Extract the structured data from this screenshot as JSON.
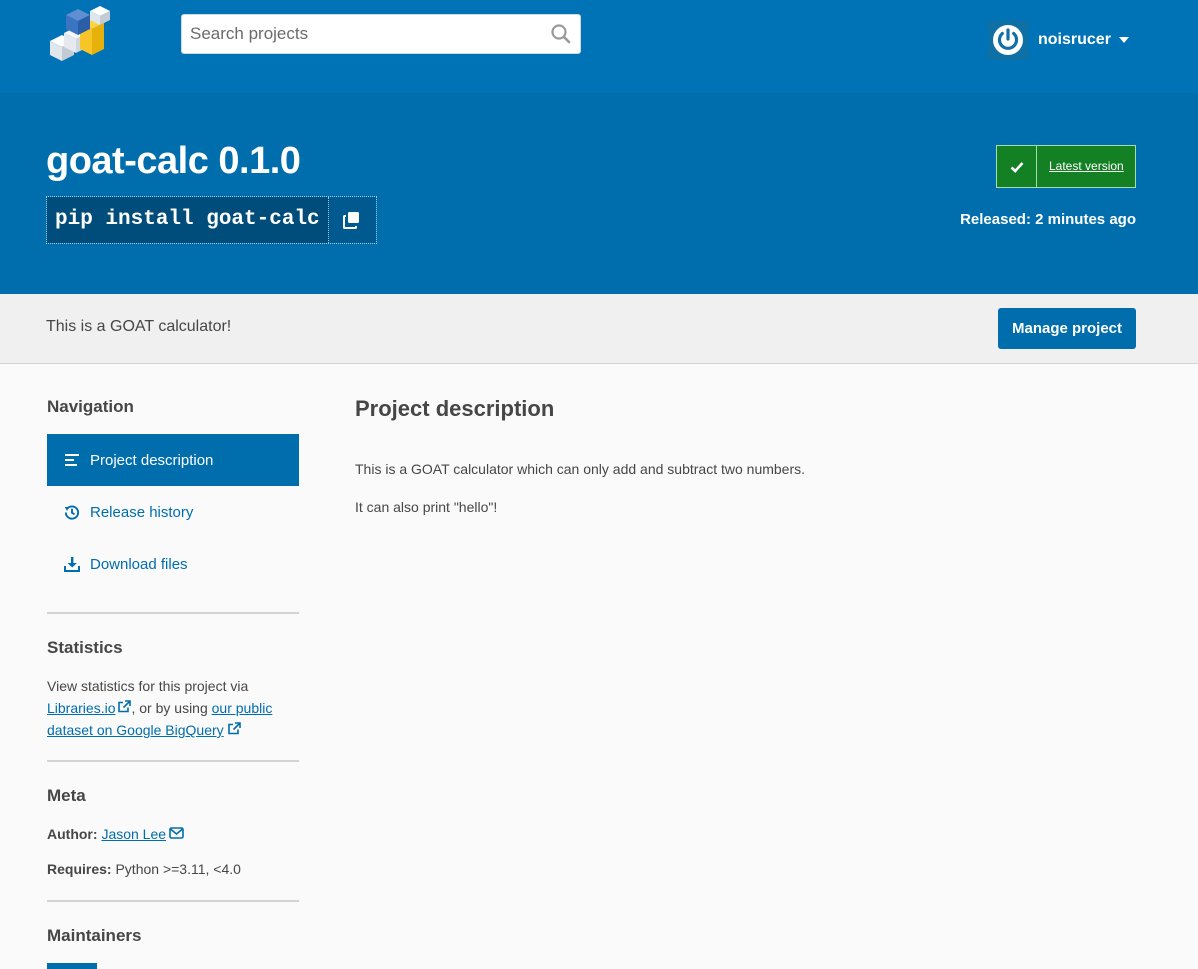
{
  "header": {
    "search_placeholder": "Search projects",
    "username": "noisrucer"
  },
  "banner": {
    "title": "goat-calc 0.1.0",
    "pip_command": "pip install goat-calc",
    "latest_label": "Latest version",
    "released": "Released: 2 minutes ago"
  },
  "summary": {
    "text": "This is a GOAT calculator!",
    "manage_label": "Manage project"
  },
  "sidebar": {
    "navigation_heading": "Navigation",
    "nav_items": [
      {
        "label": "Project description",
        "icon": "align-left-icon",
        "active": true
      },
      {
        "label": "Release history",
        "icon": "history-icon",
        "active": false
      },
      {
        "label": "Download files",
        "icon": "download-icon",
        "active": false
      }
    ],
    "statistics_heading": "Statistics",
    "statistics_text_1": "View statistics for this project via",
    "statistics_link_1": "Libraries.io",
    "statistics_text_2": ", or by using",
    "statistics_link_2a": "our public",
    "statistics_link_2b": "dataset on Google BigQuery",
    "meta_heading": "Meta",
    "author_label": "Author:",
    "author_name": "Jason Lee",
    "requires_label": "Requires:",
    "requires_value": "Python >=3.11, <4.0",
    "maintainers_heading": "Maintainers"
  },
  "main": {
    "heading": "Project description",
    "paragraph_1": "This is a GOAT calculator which can only add and subtract two numbers.",
    "paragraph_2": "It can also print \"hello\"!"
  },
  "colors": {
    "header_blue": "#0073b7",
    "banner_blue": "#006dad",
    "link_blue": "#006dad",
    "latest_green": "#148024"
  }
}
